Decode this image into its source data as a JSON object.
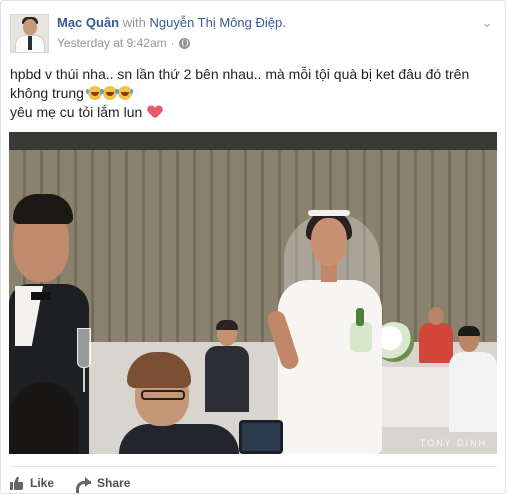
{
  "post": {
    "author": "Mạc Quân",
    "with_text": "with",
    "tagged": "Nguyễn Thị Mông Điệp.",
    "timestamp": "Yesterday at 9:42am",
    "separator": "·",
    "privacy_icon": "globe-icon",
    "menu_icon": "chevron-down-icon",
    "caption": {
      "line1": "hpbd v thúi nha.. sn lần thứ 2 bên nhau.. mà mỗi tội quà bị ket đâu đó trên",
      "line2": "không trung",
      "line2_emoji": [
        "laughing-tears-emoji",
        "laughing-tears-emoji",
        "laughing-tears-emoji"
      ],
      "line3": "yêu mẹ cu tỏi lắm lun",
      "line3_emoji": "heart-emoji"
    },
    "photo": {
      "watermark": "TONY DINH"
    },
    "actions": {
      "like_label": "Like",
      "share_label": "Share"
    }
  },
  "colors": {
    "link": "#365899",
    "meta": "#90949c",
    "text": "#1d2129",
    "border": "#dddfe2",
    "heart": "#e85a6b"
  }
}
